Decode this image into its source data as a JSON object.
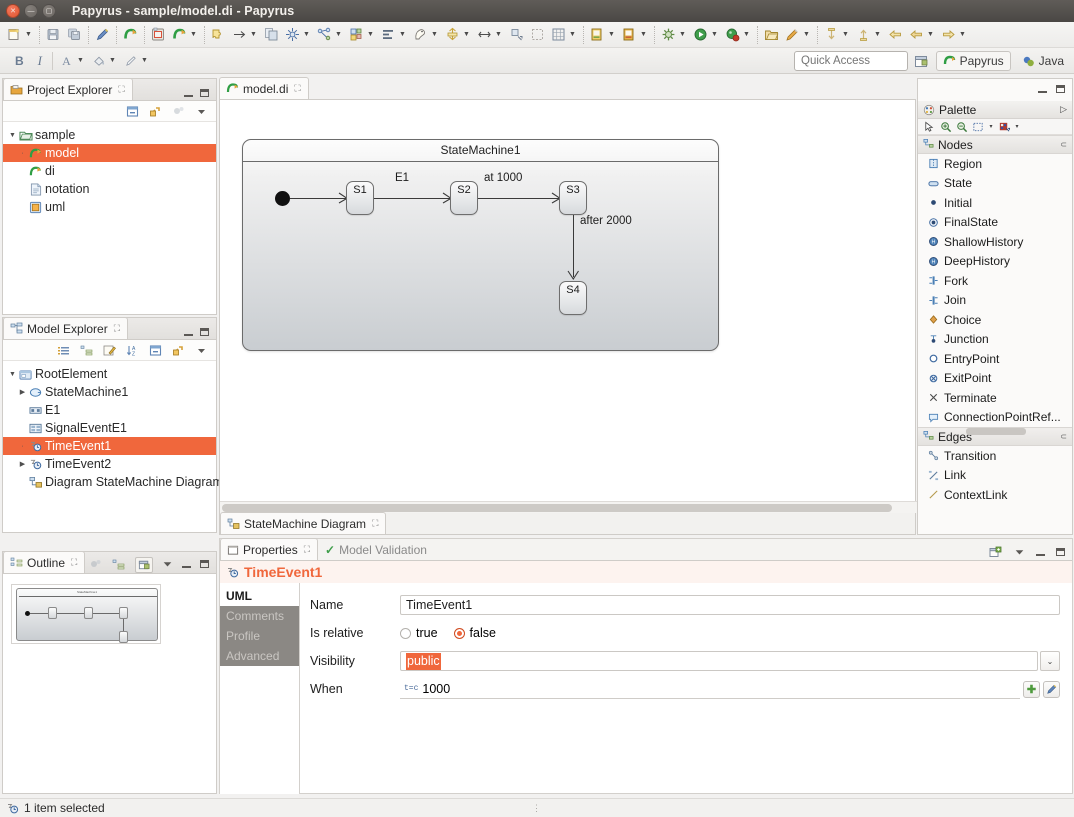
{
  "window": {
    "title": "Papyrus - sample/model.di - Papyrus",
    "controls": [
      "close",
      "minimize",
      "maximize"
    ]
  },
  "toolbar_row1": [
    {
      "name": "new-wizard",
      "glyph": "🗋",
      "arrow": true
    },
    {
      "sep": true
    },
    {
      "name": "save",
      "glyph": "💾",
      "arrow": false
    },
    {
      "name": "save-all",
      "glyph": "🗐",
      "arrow": false
    },
    {
      "sep": true
    },
    {
      "name": "edit-pencil",
      "glyph": "✎",
      "arrow": false
    },
    {
      "sep": true
    },
    {
      "name": "papyrus-perspective",
      "glyph": "↷",
      "arrow": false
    },
    {
      "sep": true
    },
    {
      "name": "new-papyrus-model",
      "glyph": "🗂",
      "arrow": false
    },
    {
      "name": "papyrus-redo",
      "glyph": "↷",
      "arrow": true
    },
    {
      "sep": true
    },
    {
      "name": "link-puzzle",
      "glyph": "⛓",
      "arrow": false
    },
    {
      "name": "arrow-right",
      "glyph": "→",
      "arrow": true
    },
    {
      "name": "copy-page",
      "glyph": "🗐",
      "arrow": false
    },
    {
      "name": "layout-graph",
      "glyph": "✸",
      "arrow": true
    },
    {
      "name": "arrange-nodes",
      "glyph": "⚯",
      "arrow": true
    },
    {
      "name": "align-grid",
      "glyph": "▦",
      "arrow": true
    },
    {
      "name": "align-left",
      "glyph": "▤",
      "arrow": true
    },
    {
      "name": "bird-view",
      "glyph": "☙",
      "arrow": true
    },
    {
      "name": "distribute",
      "glyph": "⇕",
      "arrow": true
    },
    {
      "name": "resize-horizontal",
      "glyph": "↔",
      "arrow": true
    },
    {
      "name": "snap-back",
      "glyph": "⬑",
      "arrow": false
    },
    {
      "name": "select-area",
      "glyph": "▫",
      "arrow": false
    },
    {
      "name": "grid-toggle",
      "glyph": "▩",
      "arrow": true
    },
    {
      "sep": true
    },
    {
      "name": "open-type",
      "glyph": "📒",
      "arrow": true
    },
    {
      "name": "open-resource",
      "glyph": "📔",
      "arrow": true
    },
    {
      "sep": true
    },
    {
      "name": "external-tools",
      "glyph": "⚙",
      "arrow": true
    },
    {
      "name": "run",
      "glyph": "▶",
      "arrow": true
    },
    {
      "name": "debug",
      "glyph": "🐞",
      "arrow": true
    },
    {
      "sep": true
    },
    {
      "name": "open-folder",
      "glyph": "🗁",
      "arrow": false
    },
    {
      "name": "search",
      "glyph": "🖊",
      "arrow": true
    },
    {
      "sep": true
    },
    {
      "name": "next-annotation",
      "glyph": "⬇",
      "arrow": true
    },
    {
      "name": "previous-annotation",
      "glyph": "⬆",
      "arrow": true
    },
    {
      "name": "back",
      "glyph": "⇦",
      "arrow": false
    },
    {
      "name": "forward-prev",
      "glyph": "⇦",
      "arrow": true
    },
    {
      "name": "forward",
      "glyph": "⇨",
      "arrow": true
    }
  ],
  "toolbar_row2": [
    {
      "name": "bold-button",
      "label": "B"
    },
    {
      "name": "italic-button",
      "label": "I"
    },
    {
      "sep": true
    },
    {
      "name": "font-color",
      "glyph": "A",
      "arrow": true
    },
    {
      "name": "fill-color",
      "glyph": "🎨",
      "arrow": true
    },
    {
      "name": "line-color",
      "glyph": "🖌",
      "arrow": true
    }
  ],
  "quick_access": {
    "placeholder": "Quick Access",
    "value": ""
  },
  "perspectives": {
    "open_perspective_icon": "open-perspective-icon",
    "items": [
      {
        "label": "Papyrus",
        "active": true,
        "icon": "papyrus-icon"
      },
      {
        "label": "Java",
        "active": false,
        "icon": "java-icon"
      }
    ]
  },
  "project_explorer": {
    "tab": "Project Explorer",
    "toolbar_icons": [
      "collapse-all-icon",
      "link-with-editor-icon",
      "focus-icon",
      "view-menu-icon"
    ],
    "tree": [
      {
        "label": "sample",
        "icon": "project-folder-icon",
        "depth": 0,
        "twisty": "open",
        "selected": false
      },
      {
        "label": "model",
        "icon": "papyrus-model-icon",
        "depth": 1,
        "twisty": "dot",
        "selected": true
      },
      {
        "label": "di",
        "icon": "papyrus-di-icon",
        "depth": 1,
        "twisty": "none",
        "selected": false
      },
      {
        "label": "notation",
        "icon": "notation-file-icon",
        "depth": 1,
        "twisty": "none",
        "selected": false
      },
      {
        "label": "uml",
        "icon": "uml-file-icon",
        "depth": 1,
        "twisty": "none",
        "selected": false
      }
    ]
  },
  "model_explorer": {
    "tab": "Model Explorer",
    "toolbar_icons": [
      "list-icon",
      "tree-icon",
      "edit-icon",
      "sort-az-icon",
      "collapse-all-icon",
      "link-with-editor-icon",
      "view-menu-icon"
    ],
    "tree": [
      {
        "label": "RootElement",
        "icon": "root-model-icon",
        "depth": 0,
        "twisty": "open",
        "selected": false
      },
      {
        "label": "StateMachine1",
        "icon": "statemachine-icon",
        "depth": 1,
        "twisty": "closed",
        "selected": false
      },
      {
        "label": "E1",
        "icon": "signal-icon",
        "depth": 1,
        "twisty": "none",
        "selected": false
      },
      {
        "label": "SignalEventE1",
        "icon": "signal-event-icon",
        "depth": 1,
        "twisty": "none",
        "selected": false
      },
      {
        "label": "TimeEvent1",
        "icon": "time-event-icon",
        "depth": 1,
        "twisty": "dot",
        "selected": true
      },
      {
        "label": "TimeEvent2",
        "icon": "time-event-icon",
        "depth": 1,
        "twisty": "closed",
        "selected": false
      },
      {
        "label": "Diagram StateMachine Diagram",
        "icon": "diagram-icon",
        "depth": 1,
        "twisty": "none",
        "selected": false
      }
    ]
  },
  "outline": {
    "tab": "Outline",
    "toolbar_icons": [
      "page-icon",
      "tree-icon",
      "thumbnail-icon",
      "view-menu-icon"
    ]
  },
  "editor": {
    "tab": "model.di",
    "bottom_tab": "StateMachine Diagram",
    "diagram": {
      "title": "StateMachine1",
      "states": [
        {
          "name": "S1"
        },
        {
          "name": "S2"
        },
        {
          "name": "S3"
        },
        {
          "name": "S4"
        }
      ],
      "transitions": [
        {
          "label": "",
          "from": "initial",
          "to": "S1"
        },
        {
          "label": "E1",
          "from": "S1",
          "to": "S2"
        },
        {
          "label": "at 1000",
          "from": "S2",
          "to": "S3"
        },
        {
          "label": "after 2000",
          "from": "S3",
          "to": "S4"
        }
      ]
    }
  },
  "palette": {
    "title": "Palette",
    "collapse_glyph": "▷",
    "tools": [
      "select-tool-icon",
      "zoom-in-icon",
      "zoom-out-icon",
      "marquee-icon",
      "marquee-dropdown-icon",
      "format-icon",
      "format-dropdown-icon"
    ],
    "groups": [
      {
        "name": "Nodes",
        "collapse_glyph": "⊂",
        "items": [
          {
            "label": "Region",
            "icon": "region-icon"
          },
          {
            "label": "State",
            "icon": "state-icon"
          },
          {
            "label": "Initial",
            "icon": "initial-icon"
          },
          {
            "label": "FinalState",
            "icon": "finalstate-icon"
          },
          {
            "label": "ShallowHistory",
            "icon": "shallowhistory-icon"
          },
          {
            "label": "DeepHistory",
            "icon": "deephistory-icon"
          },
          {
            "label": "Fork",
            "icon": "fork-icon"
          },
          {
            "label": "Join",
            "icon": "join-icon"
          },
          {
            "label": "Choice",
            "icon": "choice-icon"
          },
          {
            "label": "Junction",
            "icon": "junction-icon"
          },
          {
            "label": "EntryPoint",
            "icon": "entrypoint-icon"
          },
          {
            "label": "ExitPoint",
            "icon": "exitpoint-icon"
          },
          {
            "label": "Terminate",
            "icon": "terminate-icon"
          },
          {
            "label": "ConnectionPointRef...",
            "icon": "connectionpointref-icon"
          }
        ]
      },
      {
        "name": "Edges",
        "collapse_glyph": "⊂",
        "items": [
          {
            "label": "Transition",
            "icon": "transition-icon"
          },
          {
            "label": "Link",
            "icon": "link-icon"
          },
          {
            "label": "ContextLink",
            "icon": "contextlink-icon"
          }
        ]
      }
    ]
  },
  "properties": {
    "tabs": [
      {
        "label": "Properties",
        "active": true,
        "icon": "properties-icon"
      },
      {
        "label": "Model Validation",
        "active": false,
        "icon": "validation-check-icon"
      }
    ],
    "toolbar_icons": [
      "new-view-icon",
      "view-menu-icon",
      "minimize-icon",
      "maximize-icon"
    ],
    "selected_element": {
      "name": "TimeEvent1",
      "icon": "time-event-icon"
    },
    "side_tabs": [
      {
        "label": "UML",
        "active": true
      },
      {
        "label": "Comments",
        "active": false
      },
      {
        "label": "Profile",
        "active": false
      },
      {
        "label": "Advanced",
        "active": false
      }
    ],
    "fields": {
      "name_label": "Name",
      "name_value": "TimeEvent1",
      "is_relative_label": "Is relative",
      "is_relative_options": [
        {
          "label": "true",
          "selected": false
        },
        {
          "label": "false",
          "selected": true
        }
      ],
      "visibility_label": "Visibility",
      "visibility_value": "public",
      "when_label": "When",
      "when_value": "1000",
      "when_icon": "t=c",
      "add_button_glyph": "✚",
      "edit_button_glyph": "✎",
      "dropdown_glyph": "⌄"
    }
  },
  "statusbar": {
    "icon": "time-event-icon",
    "text": "1 item selected"
  },
  "colors": {
    "selection_orange": "#f0673c",
    "titlebar": "#544f4b",
    "panel_bg": "#ffffff",
    "chrome": "#f2f1f0"
  }
}
